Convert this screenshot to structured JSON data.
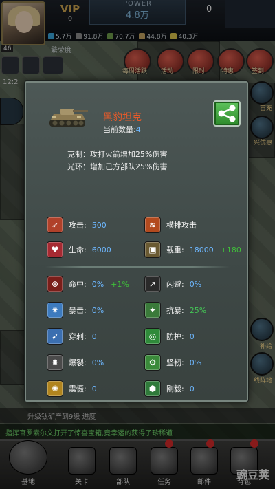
{
  "hud": {
    "vip_label": "VIP",
    "vip_level": "0",
    "power_label": "POWER",
    "power_value": "4.8万",
    "right_count": "0",
    "resources": [
      {
        "icon": "oil-icon",
        "value": "5.7万",
        "color": "#3aa4d8"
      },
      {
        "icon": "steel-icon",
        "value": "91.8万",
        "color": "#8a8a8a"
      },
      {
        "icon": "rare-earth-icon",
        "value": "70.7万",
        "color": "#6e9a4a"
      },
      {
        "icon": "titanium-icon",
        "value": "44.8万",
        "color": "#c0a060"
      },
      {
        "icon": "gold-icon",
        "value": "40.3万",
        "color": "#d8c04a"
      }
    ],
    "prosperity_label": "繁荣度",
    "level": "46",
    "clock": "12:2",
    "menu": [
      {
        "label": "每周活跃",
        "icon": "calendar-icon"
      },
      {
        "label": "活动",
        "icon": "event-icon"
      },
      {
        "label": "限时",
        "icon": "clock-icon"
      },
      {
        "label": "特惠",
        "icon": "gift-icon"
      },
      {
        "label": "签到",
        "icon": "signin-icon"
      }
    ],
    "right_side": [
      {
        "label": "首充"
      },
      {
        "label": "兴优惠"
      }
    ],
    "bottom_right_side": [
      {
        "label": "补给"
      },
      {
        "label": "线阵地"
      }
    ]
  },
  "dialog": {
    "unit_name": "黑豹坦克",
    "count_label": "当前数量:",
    "count_value": "4",
    "counter_text": "克制：攻打火箭增加25%伤害",
    "aura_text": "光环：增加己方部队25%伤害",
    "primary_stats": [
      {
        "label": "攻击:",
        "value": "500",
        "bonus": "",
        "icon": "attack-icon",
        "color": "#b0412a"
      },
      {
        "label": "横排攻击",
        "value": "",
        "bonus": "",
        "icon": "row-attack-icon",
        "color": "#b34a1e"
      },
      {
        "label": "生命:",
        "value": "6000",
        "bonus": "",
        "icon": "health-icon",
        "color": "#a62a32"
      },
      {
        "label": "载重:",
        "value": "18000",
        "bonus": "+180",
        "icon": "cargo-icon",
        "color": "#6a5a32"
      }
    ],
    "secondary_stats": [
      {
        "label": "命中:",
        "value": "0%",
        "bonus": "+1%",
        "icon": "accuracy-icon",
        "color": "#7a1e1a"
      },
      {
        "label": "闪避:",
        "value": "0%",
        "bonus": "",
        "icon": "dodge-icon",
        "color": "#2a2a2a"
      },
      {
        "label": "暴击:",
        "value": "0%",
        "bonus": "",
        "icon": "critical-icon",
        "color": "#3d7bbf"
      },
      {
        "label": "抗暴:",
        "value": "25%",
        "bonus": "",
        "icon": "anti-critical-icon",
        "color": "#3a7a3a",
        "value_green": true
      },
      {
        "label": "穿刺:",
        "value": "0",
        "bonus": "",
        "icon": "pierce-icon",
        "color": "#3b6fb0"
      },
      {
        "label": "防护:",
        "value": "0",
        "bonus": "",
        "icon": "protection-icon",
        "color": "#2f8a3a"
      },
      {
        "label": "爆裂:",
        "value": "0%",
        "bonus": "",
        "icon": "burst-icon",
        "color": "#4a4a4a"
      },
      {
        "label": "坚韧:",
        "value": "0%",
        "bonus": "",
        "icon": "tenacity-icon",
        "color": "#3a8a3a"
      },
      {
        "label": "震慑:",
        "value": "0",
        "bonus": "",
        "icon": "deter-icon",
        "color": "#b0841e"
      },
      {
        "label": "刚毅:",
        "value": "0",
        "bonus": "",
        "icon": "fortitude-icon",
        "color": "#2f7a3a"
      }
    ]
  },
  "task_bar": {
    "text": "升级钛矿产到9级 进度"
  },
  "notice": {
    "text": "指挥官罗素尔文打开了惊喜宝箱,竟幸运的获得了珍稀道"
  },
  "bottom_nav": [
    {
      "label": "基地"
    },
    {
      "label": "关卡"
    },
    {
      "label": "部队"
    },
    {
      "label": "任务"
    },
    {
      "label": "邮件"
    },
    {
      "label": "背包"
    }
  ],
  "watermark": "豌豆荚"
}
